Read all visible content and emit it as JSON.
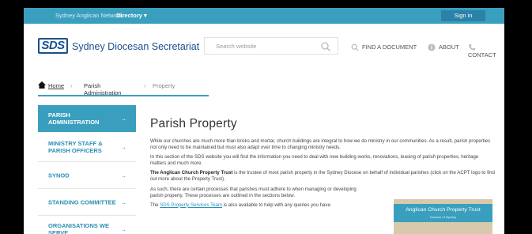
{
  "topbar": {
    "network": "Sydney Anglican Network:",
    "directory": "Directory ▾",
    "sign_in": "Sign in"
  },
  "header": {
    "logo_mark": "SDS",
    "logo_text": "Sydney Diocesan Secretariat",
    "search_placeholder": "Search website",
    "nav": [
      "FIND A DOCUMENT",
      "ABOUT",
      "CONTACT"
    ]
  },
  "breadcrumb": {
    "home": "Home",
    "sep": "›",
    "level1": "Parish Administration",
    "level2": "Property"
  },
  "sidebar": {
    "arrow": "→",
    "items": [
      {
        "label": "PARISH ADMINISTRATION"
      },
      {
        "label": "MINISTRY STAFF & PARISH OFFICERS"
      },
      {
        "label": "SYNOD"
      },
      {
        "label": "STANDING COMMITTEE"
      },
      {
        "label": "ORGANISATIONS WE SERVE"
      }
    ]
  },
  "main": {
    "title": "Parish Property",
    "p1": "While our churches are much more than bricks and mortar, church buildings are integral to how we do ministry in our communities. As a result, parish properties not only need to be maintained but must also adapt over time to changing ministry needs.",
    "p2": "In this section of the SDS website you will find the information you need to deal with new building works, renovations, leasing of parish properties, heritage matters and much more.",
    "p3_bold": "The Anglican Church Property Trust",
    "p3_rest": " is the trustee of most parish property in the Sydney Diocese on behalf of individual parishes (click on the ACPT logo to find out more about the Property Trust).",
    "p4": "As such, there are certain processes that parishes must adhere to when managing or developing parish property. These processes are outlined in the sections below.",
    "p5_link": "SDS Property Services Team",
    "p5_pre": "The ",
    "p5_rest": " is also available to help with any queries you have.",
    "acpt_title": "Anglican Church Property Trust",
    "acpt_sub": "Diocese of Sydney"
  }
}
